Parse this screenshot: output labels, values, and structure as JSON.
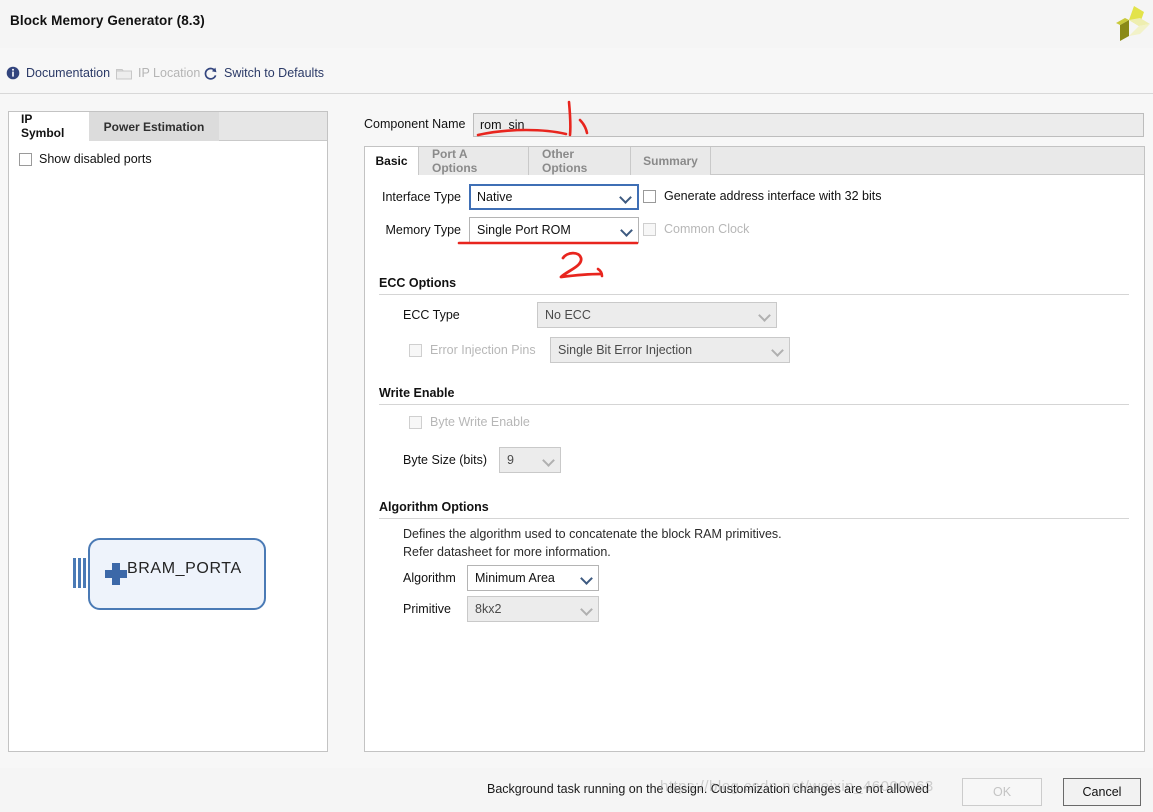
{
  "window": {
    "title": "Block Memory Generator (8.3)",
    "logo_icon": "xilinx-pinwheel-logo"
  },
  "toolbar": {
    "items": [
      {
        "label": "Documentation",
        "icon": "info-circle-icon",
        "enabled": true
      },
      {
        "label": "IP Location",
        "icon": "folder-icon",
        "enabled": false
      },
      {
        "label": "Switch to Defaults",
        "icon": "refresh-icon",
        "enabled": true
      }
    ]
  },
  "left_panel": {
    "tabs": [
      {
        "label": "IP Symbol",
        "active": true
      },
      {
        "label": "Power Estimation",
        "active": false
      }
    ],
    "show_disabled_ports": {
      "label": "Show disabled ports",
      "checked": false
    },
    "symbol": {
      "name": "BRAM_PORTA",
      "expand_icon": "plus-icon",
      "bus_icon": "bus-bars-icon"
    }
  },
  "component_name": {
    "label": "Component Name",
    "value": "rom_sin",
    "placeholder": ""
  },
  "tabs": [
    {
      "label": "Basic",
      "active": true
    },
    {
      "label": "Port A Options",
      "active": false
    },
    {
      "label": "Other Options",
      "active": false
    },
    {
      "label": "Summary",
      "active": false
    }
  ],
  "basic": {
    "interface_type": {
      "label": "Interface Type",
      "value": "Native",
      "focused": true,
      "enabled": true
    },
    "generate_address_interface": {
      "label": "Generate address interface with 32 bits",
      "checked": false,
      "enabled": true
    },
    "memory_type": {
      "label": "Memory Type",
      "value": "Single Port ROM",
      "enabled": true
    },
    "common_clock": {
      "label": "Common Clock",
      "checked": false,
      "enabled": false
    },
    "ecc_options": {
      "title": "ECC Options",
      "ecc_type": {
        "label": "ECC Type",
        "value": "No ECC",
        "enabled": false
      },
      "error_injection_pins": {
        "label": "Error Injection Pins",
        "checked": false,
        "enabled": false,
        "value": "Single Bit Error Injection"
      }
    },
    "write_enable": {
      "title": "Write Enable",
      "byte_write_enable": {
        "label": "Byte Write Enable",
        "checked": false,
        "enabled": false
      },
      "byte_size": {
        "label": "Byte Size (bits)",
        "value": "9",
        "enabled": false
      }
    },
    "algorithm_options": {
      "title": "Algorithm Options",
      "help_line_1": "Defines the algorithm used to concatenate the block RAM primitives.",
      "help_line_2": "Refer datasheet for more information.",
      "algorithm": {
        "label": "Algorithm",
        "value": "Minimum Area",
        "enabled": true
      },
      "primitive": {
        "label": "Primitive",
        "value": "8kx2",
        "enabled": false
      }
    }
  },
  "footer": {
    "status": "Background task running on the design. Customization changes are not allowed",
    "ok_label": "OK",
    "ok_enabled": false,
    "cancel_label": "Cancel",
    "cancel_enabled": true
  },
  "annotations": {
    "marker_1": "1",
    "marker_2": "2",
    "color": "#e8251e"
  },
  "watermark": {
    "text": "https://blog.csdn.net/weixin_46000063"
  }
}
